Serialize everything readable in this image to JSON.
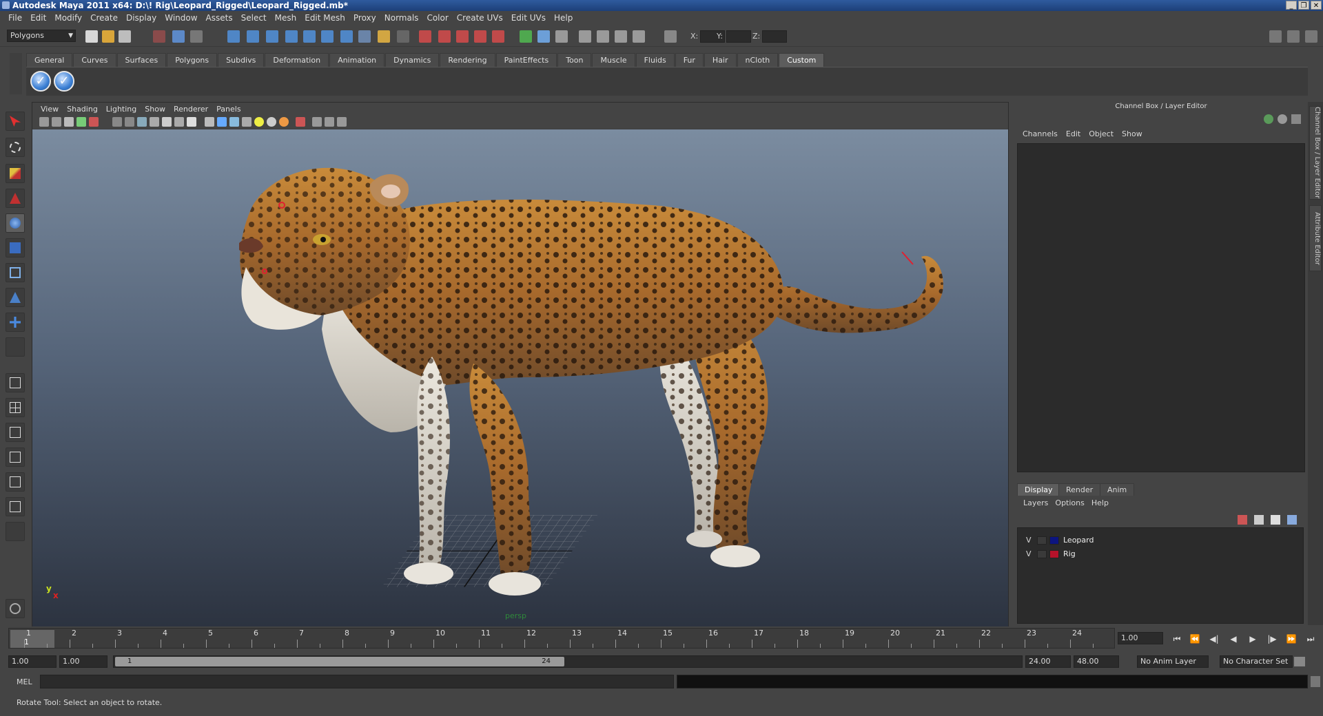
{
  "window": {
    "title": "Autodesk Maya 2011 x64: D:\\! Rig\\Leopard_Rigged\\Leopard_Rigged.mb*",
    "controls": [
      "minimize-icon",
      "restore-icon",
      "close-icon"
    ]
  },
  "menubar": [
    "File",
    "Edit",
    "Modify",
    "Create",
    "Display",
    "Window",
    "Assets",
    "Select",
    "Mesh",
    "Edit Mesh",
    "Proxy",
    "Normals",
    "Color",
    "Create UVs",
    "Edit UVs",
    "Help"
  ],
  "statusline": {
    "mode": "Polygons",
    "x_label": "X:",
    "y_label": "Y:",
    "z_label": "Z:"
  },
  "shelf": {
    "tabs": [
      "General",
      "Curves",
      "Surfaces",
      "Polygons",
      "Subdivs",
      "Deformation",
      "Animation",
      "Dynamics",
      "Rendering",
      "PaintEffects",
      "Toon",
      "Muscle",
      "Fluids",
      "Fur",
      "Hair",
      "nCloth",
      "Custom"
    ],
    "active_tab": "Custom",
    "buttons": [
      "✓",
      "✓"
    ]
  },
  "viewport": {
    "menu": [
      "View",
      "Shading",
      "Lighting",
      "Show",
      "Renderer",
      "Panels"
    ],
    "camera_label": "persp",
    "axis_x": "x",
    "axis_y": "y"
  },
  "channelbox": {
    "title": "Channel Box / Layer Editor",
    "menu": [
      "Channels",
      "Edit",
      "Object",
      "Show"
    ]
  },
  "layereditor": {
    "tabs": [
      "Display",
      "Render",
      "Anim"
    ],
    "active_tab": "Display",
    "menu": [
      "Layers",
      "Options",
      "Help"
    ],
    "layers": [
      {
        "visible": "V",
        "name": "Leopard",
        "color": "#0c1580"
      },
      {
        "visible": "V",
        "name": "Rig",
        "color": "#b5122a"
      }
    ]
  },
  "side_tabs": [
    "Channel Box / Layer Editor",
    "Attribute Editor"
  ],
  "timeslider": {
    "ticks": [
      "1",
      "2",
      "3",
      "4",
      "5",
      "6",
      "7",
      "8",
      "9",
      "10",
      "11",
      "12",
      "13",
      "14",
      "15",
      "16",
      "17",
      "18",
      "19",
      "20",
      "21",
      "22",
      "23",
      "24"
    ],
    "current_frame": "1",
    "current_time": "1.00"
  },
  "range": {
    "start": "1.00",
    "anim_start": "1.00",
    "slider_start": "1",
    "slider_end": "24",
    "anim_end": "24.00",
    "end": "48.00",
    "anim_layer": "No Anim Layer",
    "character_set": "No Character Set"
  },
  "cmdline": {
    "label": "MEL"
  },
  "helpline": {
    "text": "Rotate Tool: Select an object to rotate."
  }
}
